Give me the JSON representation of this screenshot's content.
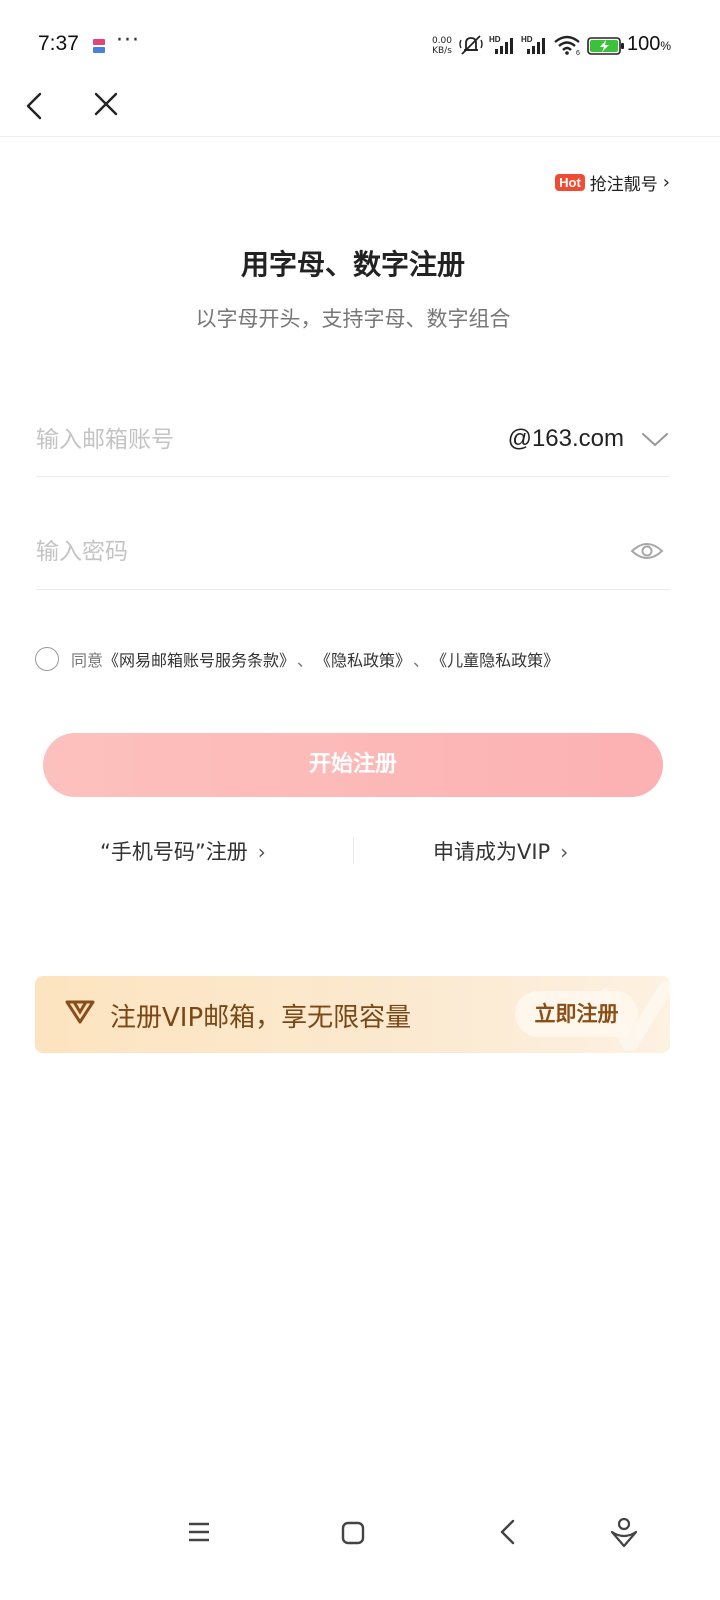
{
  "status_bar": {
    "time": "7:37",
    "more": "···",
    "net_speed_value": "0.00",
    "net_speed_unit": "KB/s",
    "battery_percent": "100",
    "battery_unit": "%"
  },
  "hot": {
    "badge": "Hot",
    "label": "抢注靓号",
    "chevron": "›"
  },
  "title": "用字母、数字注册",
  "subtitle": "以字母开头，支持字母、数字组合",
  "email": {
    "placeholder": "输入邮箱账号",
    "domain": "@163.com"
  },
  "password": {
    "placeholder": "输入密码"
  },
  "agreement": {
    "prefix": "同意",
    "links": [
      "《网易邮箱账号服务条款》",
      "《隐私政策》",
      "《儿童隐私政策》"
    ],
    "separator": "、"
  },
  "submit_label": "开始注册",
  "secondary_links": {
    "phone_register": "“手机号码”注册",
    "vip_apply": "申请成为VIP",
    "chevron": "›"
  },
  "vip_banner": {
    "text": "注册VIP邮箱，享无限容量",
    "button": "立即注册"
  },
  "icons": {
    "back": "chevron-left-icon",
    "close": "close-icon",
    "dropdown": "chevron-down-icon",
    "eye": "eye-icon",
    "menu": "menu-icon",
    "home": "home-icon",
    "nav_back": "back-icon",
    "assistant": "assistant-icon"
  },
  "colors": {
    "hot_badge": "#ef4c33",
    "submit_gradient_start": "#fdc1bd",
    "submit_gradient_end": "#fcb1b2",
    "vip_text": "#7a4716",
    "battery": "#3cc13b"
  }
}
